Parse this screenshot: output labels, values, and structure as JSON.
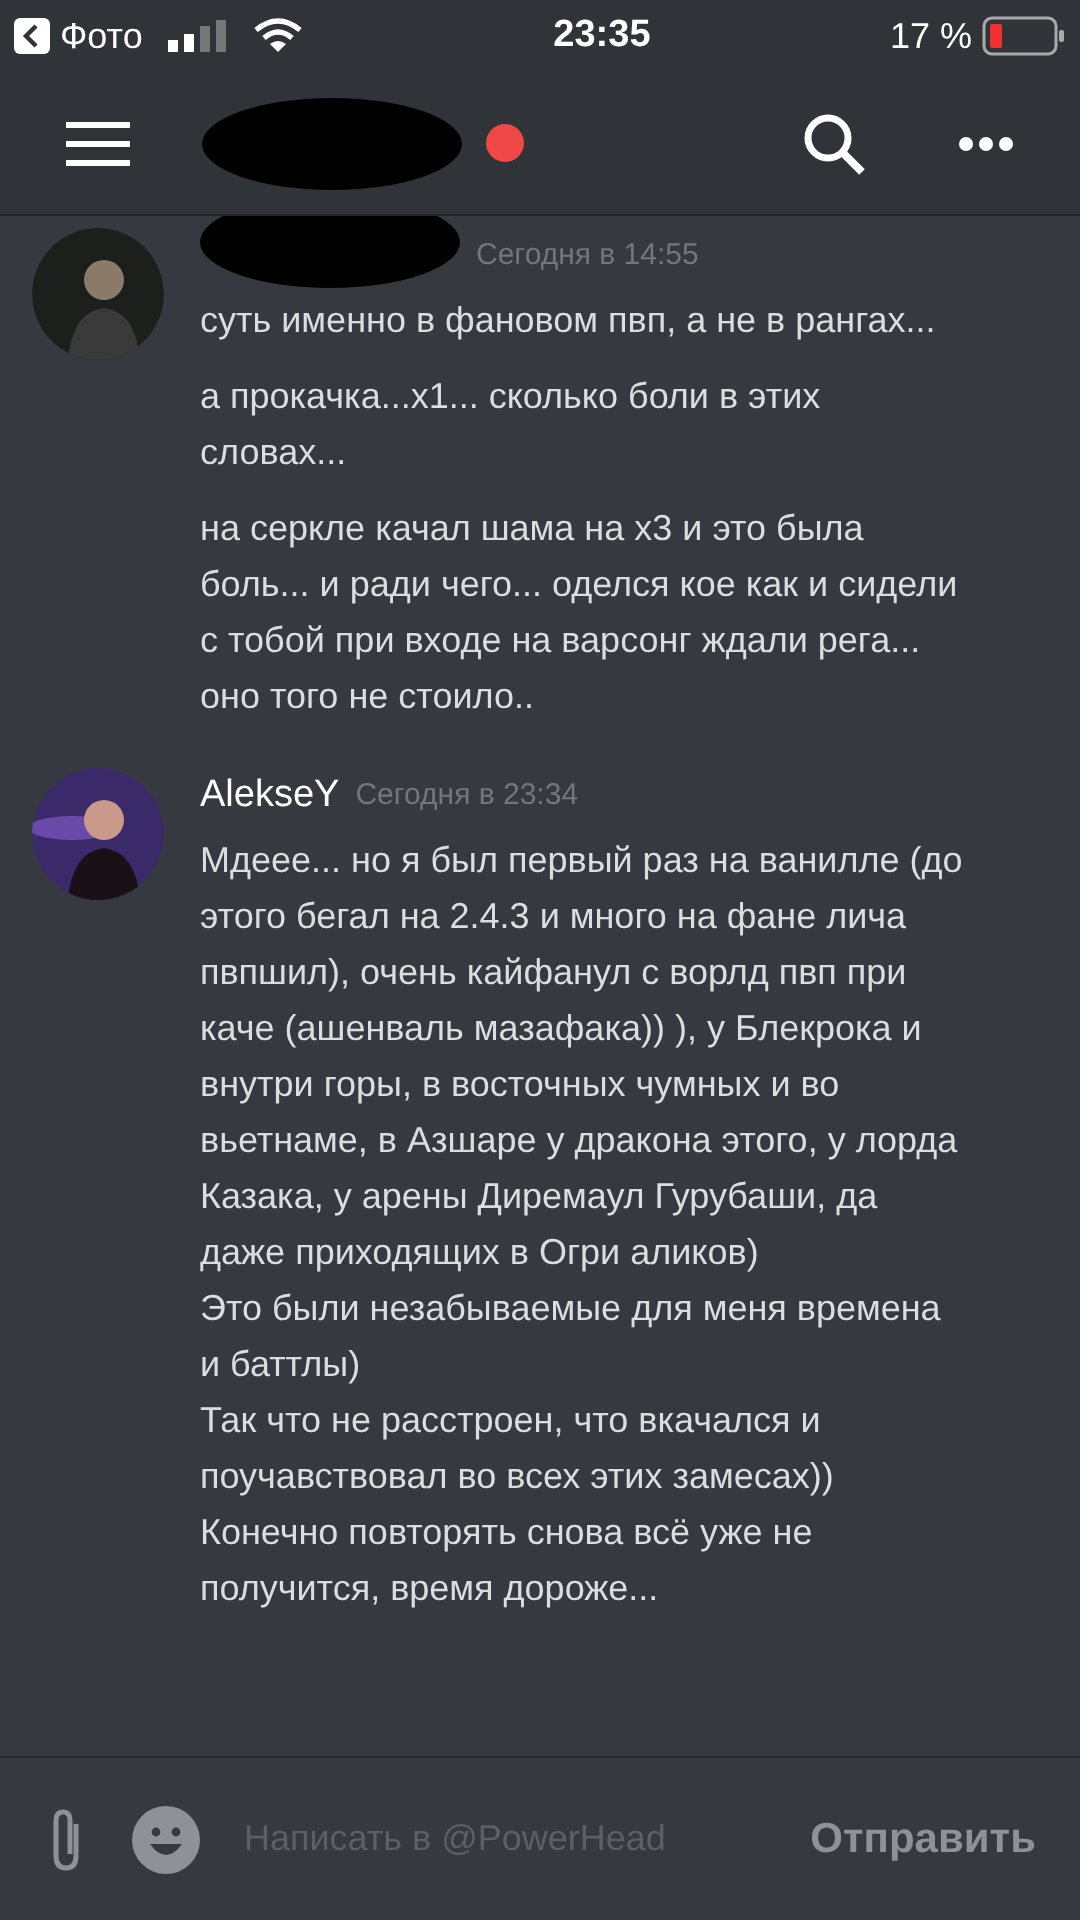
{
  "status_bar": {
    "back_label": "Фото",
    "time": "23:35",
    "battery": "17 %"
  },
  "header": {
    "color": "#f04747"
  },
  "messages": [
    {
      "author_hidden": true,
      "timestamp": "Сегодня в 14:55",
      "paragraphs": [
        "суть именно в фановом пвп, а не в рангах...",
        "а прокачка...х1... сколько боли в этих словах...",
        "на серкле качал шама на х3 и это была боль... и ради чего... оделся кое как и сидели с тобой при входе на варсонг ждали рега... оно того не стоило.."
      ]
    },
    {
      "author": "AlekseY",
      "timestamp": "Сегодня в 23:34",
      "paragraphs": [
        "Мдеее... но я был первый раз на ванилле (до этого бегал на 2.4.3 и много на фане лича пвпшил), очень кайфанул с ворлд пвп при каче (ашенваль мазафака)) ), у Блекрока и внутри горы, в восточных чумных и во вьетнаме, в Азшаре у дракона этого, у лорда Казака, у арены Диремаул Гурубаши, да даже приходящих в Огри аликов)\nЭто были незабываемые для меня времена и баттлы)\nТак что не расстроен, что вкачался и поучавствовал во всех этих замесах))\nКонечно повторять снова всё уже не получится, время дороже..."
      ]
    }
  ],
  "composer": {
    "placeholder": "Написать в @PowerHead",
    "send_label": "Отправить"
  }
}
